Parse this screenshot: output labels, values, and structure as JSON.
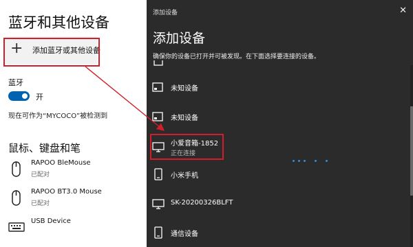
{
  "settings": {
    "title": "蓝牙和其他设备",
    "add_button_label": "添加蓝牙或其他设备",
    "bluetooth_label": "蓝牙",
    "toggle_state_text": "开",
    "discoverable_text": "现在可作为“MYCOCO”被检测到",
    "section_title": "鼠标、键盘和笔",
    "devices": [
      {
        "name": "RAPOO BleMouse",
        "status": "已配对",
        "icon": "mouse-icon"
      },
      {
        "name": "RAPOO BT3.0 Mouse",
        "status": "已配对",
        "icon": "mouse-icon"
      },
      {
        "name": "USB Device",
        "status": "",
        "icon": "keyboard-icon"
      }
    ]
  },
  "dialog": {
    "title": "添加设备",
    "close": "✕",
    "heading": "添加设备",
    "subtitle": "确保你的设备已打开并可被发现。在下面选择要连接的设备。",
    "items": [
      {
        "name": "未知设备",
        "status": "",
        "icon": "display-icon"
      },
      {
        "name": "未知设备",
        "status": "",
        "icon": "display-icon"
      },
      {
        "name": "小爱音箱-1852",
        "status": "正在连接",
        "icon": "monitor-icon"
      },
      {
        "name": "小米手机",
        "status": "",
        "icon": "phone-icon"
      },
      {
        "name": "SK-20200326BLFT",
        "status": "",
        "icon": "monitor-icon"
      },
      {
        "name": "通信设备",
        "status": "",
        "icon": "phone-icon"
      }
    ]
  },
  "colors": {
    "dialog_bg": "#2b2b2b",
    "accent": "#0063b1",
    "highlight": "#d01f2a"
  }
}
